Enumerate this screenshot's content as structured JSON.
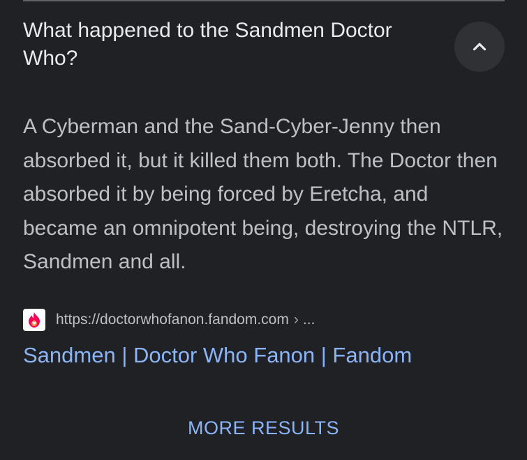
{
  "question": {
    "text": "What happened to the Sandmen Doctor Who?"
  },
  "collapse_button": {
    "icon": "chevron-up-icon"
  },
  "answer": {
    "text": "A Cyberman and the Sand-Cyber-Jenny then absorbed it, but it killed them both. The Doctor then absorbed it by being forced by Eretcha, and became an omnipotent being, destroying the NTLR, Sandmen and all."
  },
  "source": {
    "favicon": "fandom-flame-icon",
    "url": "https://doctorwhofanon.fandom.com",
    "separator": "›",
    "more": "..."
  },
  "result_link": {
    "title": "Sandmen | Doctor Who Fanon | Fandom"
  },
  "more_results": {
    "label": "MORE RESULTS"
  },
  "colors": {
    "background": "#202124",
    "title_text": "#e8eaed",
    "body_text": "#bdc1c6",
    "link": "#8ab4f8",
    "button_bg": "#303134"
  }
}
